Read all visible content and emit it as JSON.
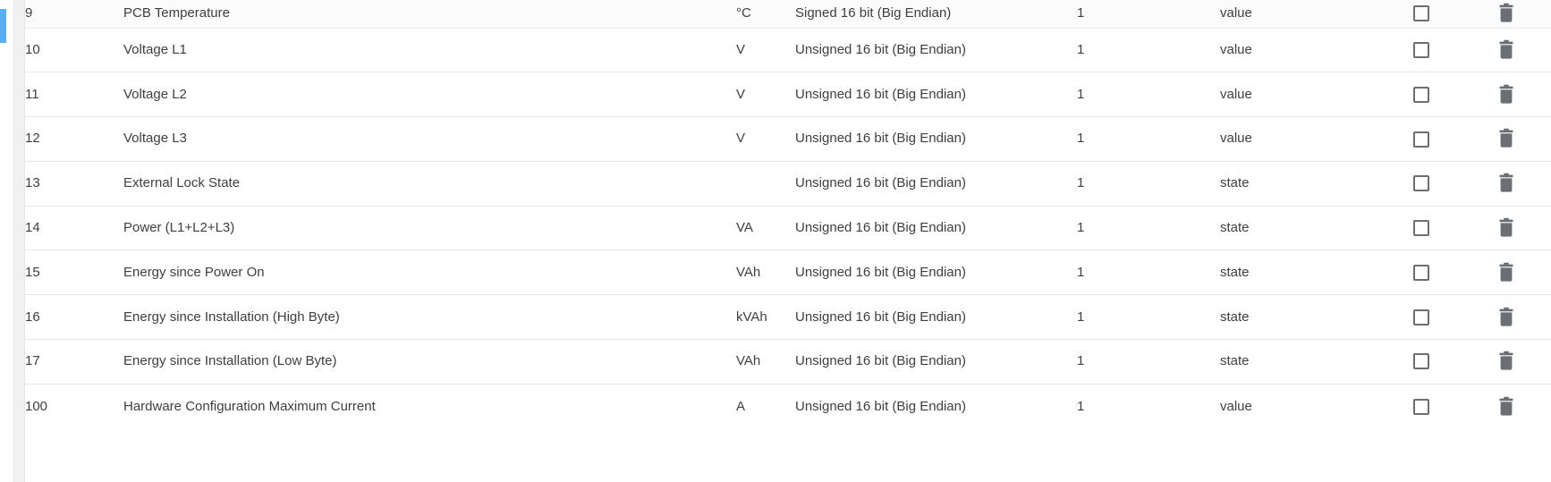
{
  "table": {
    "columns": [
      "id",
      "name",
      "unit",
      "data_type",
      "scale",
      "kind",
      "select",
      "delete"
    ],
    "icons": {
      "checkbox": "checkbox-unchecked-icon",
      "delete": "trash-icon"
    },
    "rows": [
      {
        "id": "9",
        "name": "PCB Temperature",
        "unit": "°C",
        "data_type": "Signed 16 bit (Big Endian)",
        "scale": "1",
        "kind": "value",
        "selected": false,
        "highlighted": true
      },
      {
        "id": "10",
        "name": "Voltage L1",
        "unit": "V",
        "data_type": "Unsigned 16 bit (Big Endian)",
        "scale": "1",
        "kind": "value",
        "selected": false,
        "highlighted": false
      },
      {
        "id": "11",
        "name": "Voltage L2",
        "unit": "V",
        "data_type": "Unsigned 16 bit (Big Endian)",
        "scale": "1",
        "kind": "value",
        "selected": false,
        "highlighted": false
      },
      {
        "id": "12",
        "name": "Voltage L3",
        "unit": "V",
        "data_type": "Unsigned 16 bit (Big Endian)",
        "scale": "1",
        "kind": "value",
        "selected": false,
        "highlighted": false
      },
      {
        "id": "13",
        "name": "External Lock State",
        "unit": "",
        "data_type": "Unsigned 16 bit (Big Endian)",
        "scale": "1",
        "kind": "state",
        "selected": false,
        "highlighted": false
      },
      {
        "id": "14",
        "name": "Power (L1+L2+L3)",
        "unit": "VA",
        "data_type": "Unsigned 16 bit (Big Endian)",
        "scale": "1",
        "kind": "state",
        "selected": false,
        "highlighted": false
      },
      {
        "id": "15",
        "name": "Energy since Power On",
        "unit": "VAh",
        "data_type": "Unsigned 16 bit (Big Endian)",
        "scale": "1",
        "kind": "state",
        "selected": false,
        "highlighted": false
      },
      {
        "id": "16",
        "name": "Energy since Installation (High Byte)",
        "unit": "kVAh",
        "data_type": "Unsigned 16 bit (Big Endian)",
        "scale": "1",
        "kind": "state",
        "selected": false,
        "highlighted": false
      },
      {
        "id": "17",
        "name": "Energy since Installation (Low Byte)",
        "unit": "VAh",
        "data_type": "Unsigned 16 bit (Big Endian)",
        "scale": "1",
        "kind": "state",
        "selected": false,
        "highlighted": false
      },
      {
        "id": "100",
        "name": "Hardware Configuration Maximum Current",
        "unit": "A",
        "data_type": "Unsigned 16 bit (Big Endian)",
        "scale": "1",
        "kind": "value",
        "selected": false,
        "highlighted": false
      }
    ]
  },
  "colors": {
    "accent": "#5aaef4",
    "row_highlight": "#f5f5f5",
    "border": "#e8e8e8",
    "text": "#3c4043",
    "icon": "#6b6f73"
  }
}
